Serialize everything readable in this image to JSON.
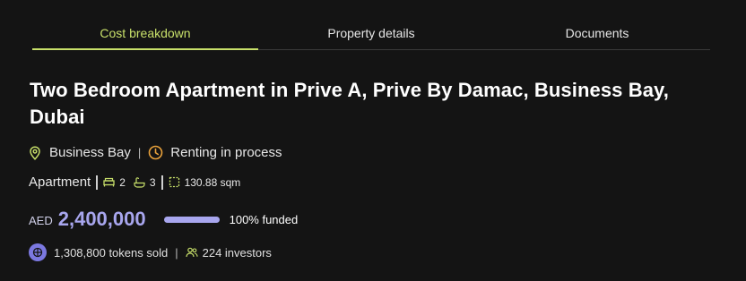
{
  "tabs": [
    {
      "label": "Cost breakdown",
      "active": true
    },
    {
      "label": "Property details",
      "active": false
    },
    {
      "label": "Documents",
      "active": false
    }
  ],
  "title": "Two Bedroom Apartment in Prive A, Prive By Damac, Business Bay, Dubai",
  "location": {
    "icon": "location-pin-icon",
    "label": "Business Bay"
  },
  "separator": "|",
  "status": {
    "icon": "clock-icon",
    "label": "Renting in process"
  },
  "property": {
    "type": "Apartment",
    "bedrooms": "2",
    "bathrooms": "3",
    "area": "130.88 sqm"
  },
  "price": {
    "currency": "AED",
    "amount": "2,400,000"
  },
  "funding": {
    "percent": 100,
    "label": "100% funded"
  },
  "tokens": {
    "label": "1,308,800 tokens sold",
    "icon": "token-icon"
  },
  "investors": {
    "label": "224 investors",
    "icon": "people-icon"
  },
  "colors": {
    "accent_green": "#c8e06a",
    "accent_purple": "#a8a6ee",
    "status_orange": "#e9a23b",
    "background": "#141414"
  }
}
